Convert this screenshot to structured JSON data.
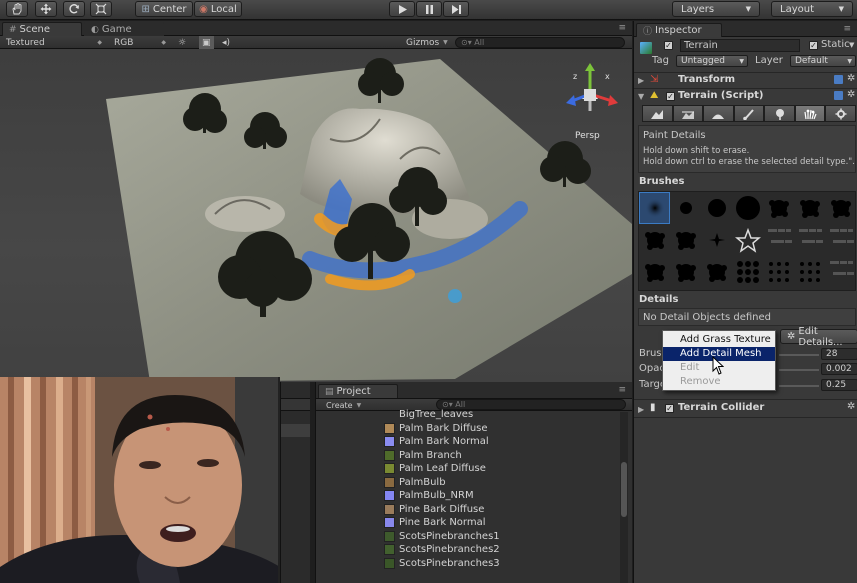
{
  "toolbar": {
    "pivot_label": "Center",
    "space_label": "Local",
    "layers_label": "Layers",
    "layout_label": "Layout"
  },
  "scene": {
    "tab_scene": "Scene",
    "tab_game": "Game",
    "draw_mode": "Textured",
    "render_mode": "RGB",
    "gizmos_label": "Gizmos",
    "search_placeholder": "All",
    "persp_label": "Persp"
  },
  "project": {
    "tab_label": "Project",
    "create_label": "Create",
    "search_placeholder": "All",
    "assets": [
      {
        "name": "BigTree_leaves",
        "color": "#303030"
      },
      {
        "name": "Palm Bark Diffuse",
        "color": "#b08a58"
      },
      {
        "name": "Palm Bark Normal",
        "color": "#8a8cf0"
      },
      {
        "name": "Palm Branch",
        "color": "#4f6b2a"
      },
      {
        "name": "Palm Leaf Diffuse",
        "color": "#7a8a32"
      },
      {
        "name": "PalmBulb",
        "color": "#8a6a40"
      },
      {
        "name": "PalmBulb_NRM",
        "color": "#8486f2"
      },
      {
        "name": "Pine Bark Diffuse",
        "color": "#9a7c5c"
      },
      {
        "name": "Pine Bark Normal",
        "color": "#8888ec"
      },
      {
        "name": "ScotsPinebranches1",
        "color": "#3e5a2c"
      },
      {
        "name": "ScotsPinebranches2",
        "color": "#42602e"
      },
      {
        "name": "ScotsPinebranches3",
        "color": "#3a5628"
      }
    ]
  },
  "inspector": {
    "tab_label": "Inspector",
    "object_name": "Terrain",
    "static_label": "Static",
    "tag_label": "Tag",
    "tag_value": "Untagged",
    "layer_label": "Layer",
    "layer_value": "Default",
    "transform_label": "Transform",
    "terrain_script_label": "Terrain (Script)",
    "paint_title": "Paint Details",
    "paint_help_1": "Hold down shift to erase.",
    "paint_help_2": "Hold down ctrl to erase the selected detail type.\".",
    "brushes_label": "Brushes",
    "details_label": "Details",
    "no_details": "No Detail Objects defined",
    "edit_details_label": "Edit Details...",
    "brush_size_label": "Brush",
    "brush_size_value": "28",
    "opacity_label": "Opac",
    "opacity_value": "0.002",
    "target_label": "Targe",
    "target_value": "0.25",
    "collider_label": "Terrain Collider"
  },
  "context_menu": {
    "items": [
      "Add Grass Texture",
      "Add Detail Mesh",
      "Edit",
      "Remove"
    ]
  },
  "colors": {
    "menu_highlight": "#0a246a",
    "selected_brush": "#3b7bc4"
  }
}
